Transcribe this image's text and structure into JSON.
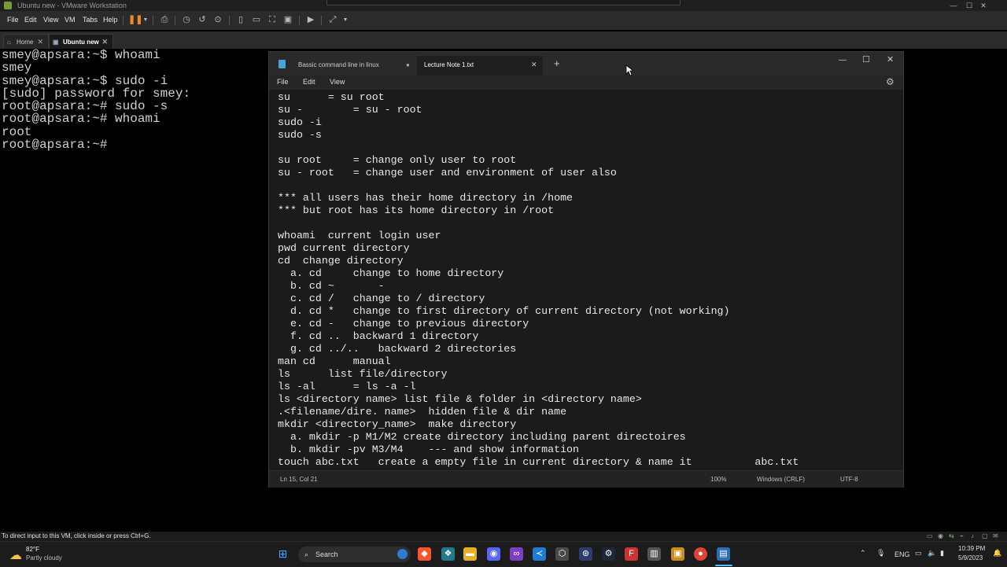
{
  "vm_window": {
    "title": "Ubuntu new - VMware Workstation",
    "menu": [
      "File",
      "Edit",
      "View",
      "VM",
      "Tabs",
      "Help"
    ],
    "tabs": [
      {
        "label": "Home"
      },
      {
        "label": "Ubuntu new"
      }
    ],
    "status_text": "To direct input to this VM, click inside or press Ctrl+G."
  },
  "terminal": {
    "lines": [
      "smey@apsara:~$ whoami",
      "smey",
      "smey@apsara:~$ sudo -i",
      "[sudo] password for smey:",
      "root@apsara:~# sudo -s",
      "root@apsara:~# whoami",
      "root",
      "root@apsara:~#"
    ]
  },
  "notepad": {
    "tabs": [
      {
        "label": "Bassic command line in linux"
      },
      {
        "label": "Lecture Note 1.txt"
      }
    ],
    "menu": [
      "File",
      "Edit",
      "View"
    ],
    "content": [
      "su      = su root",
      "su -        = su - root",
      "sudo -i",
      "sudo -s",
      "",
      "su root     = change only user to root",
      "su - root   = change user and environment of user also",
      "",
      "*** all users has their home directory in /home",
      "*** but root has its home directory in /root",
      "",
      "whoami  current login user",
      "pwd current directory",
      "cd  change directory",
      "  a. cd     change to home directory",
      "  b. cd ~       -",
      "  c. cd /   change to / directory",
      "  d. cd *   change to first directory of current directory (not working)",
      "  e. cd -   change to previous directory",
      "  f. cd ..  backward 1 directory",
      "  g. cd ../..   backward 2 directories",
      "man cd      manual",
      "ls      list file/directory",
      "ls -al      = ls -a -l",
      "ls <directory name> list file & folder in <directory name>",
      ".<filename/dire. name>  hidden file & dir name",
      "mkdir <directory_name>  make directory",
      "  a. mkdir -p M1/M2 create directory including parent directoires",
      "  b. mkdir -pv M3/M4    --- and show information",
      "touch abc.txt   create a empty file in current directory & name it          abc.txt"
    ],
    "status": {
      "position": "Ln 15, Col 21",
      "zoom": "100%",
      "line_ending": "Windows (CRLF)",
      "encoding": "UTF-8"
    }
  },
  "taskbar": {
    "weather_temp": "82°F",
    "weather_desc": "Partly cloudy",
    "search_placeholder": "Search",
    "language": "ENG",
    "time": "10:39 PM",
    "date": "5/9/2023"
  },
  "colors": {
    "accent": "#0078d4",
    "terminal_bg": "#000000",
    "editor_bg": "#1b1b1b"
  }
}
